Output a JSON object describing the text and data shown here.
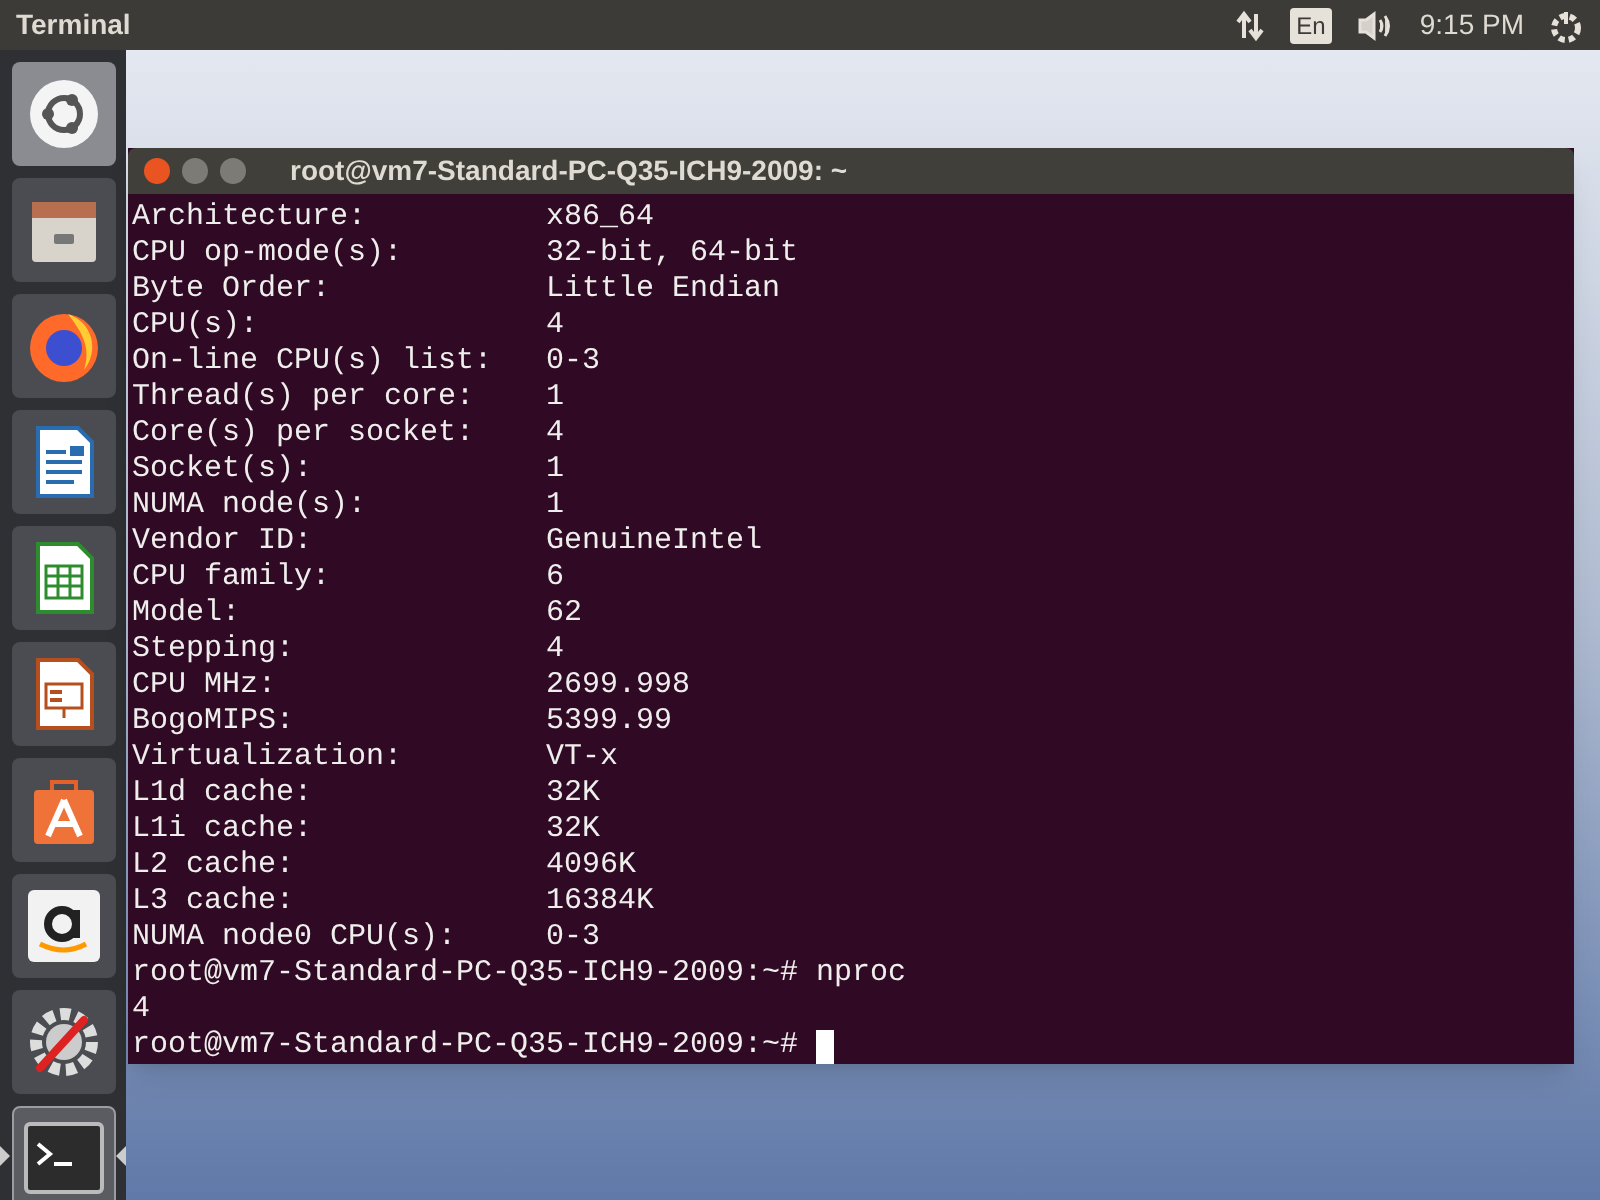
{
  "top_bar": {
    "app_title": "Terminal",
    "keyboard_layout": "En",
    "clock": "9:15 PM"
  },
  "launcher": {
    "items": [
      {
        "kind": "dash",
        "running": false
      },
      {
        "kind": "files",
        "running": false
      },
      {
        "kind": "browser",
        "running": false
      },
      {
        "kind": "writer",
        "running": false
      },
      {
        "kind": "calc",
        "running": false
      },
      {
        "kind": "impress",
        "running": false
      },
      {
        "kind": "software",
        "running": false
      },
      {
        "kind": "amazon",
        "running": false
      },
      {
        "kind": "settings",
        "running": false
      },
      {
        "kind": "terminal",
        "running": true
      }
    ]
  },
  "terminal": {
    "title": "root@vm7-Standard-PC-Q35-ICH9-2009: ~",
    "lines": [
      {
        "kind": "field",
        "label": "Architecture:",
        "value": "x86_64"
      },
      {
        "kind": "field",
        "label": "CPU op-mode(s):",
        "value": "32-bit, 64-bit"
      },
      {
        "kind": "field",
        "label": "Byte Order:",
        "value": "Little Endian"
      },
      {
        "kind": "field",
        "label": "CPU(s):",
        "value": "4"
      },
      {
        "kind": "field",
        "label": "On-line CPU(s) list:",
        "value": "0-3"
      },
      {
        "kind": "field",
        "label": "Thread(s) per core:",
        "value": "1"
      },
      {
        "kind": "field",
        "label": "Core(s) per socket:",
        "value": "4"
      },
      {
        "kind": "field",
        "label": "Socket(s):",
        "value": "1"
      },
      {
        "kind": "field",
        "label": "NUMA node(s):",
        "value": "1"
      },
      {
        "kind": "field",
        "label": "Vendor ID:",
        "value": "GenuineIntel"
      },
      {
        "kind": "field",
        "label": "CPU family:",
        "value": "6"
      },
      {
        "kind": "field",
        "label": "Model:",
        "value": "62"
      },
      {
        "kind": "field",
        "label": "Stepping:",
        "value": "4"
      },
      {
        "kind": "field",
        "label": "CPU MHz:",
        "value": "2699.998"
      },
      {
        "kind": "field",
        "label": "BogoMIPS:",
        "value": "5399.99"
      },
      {
        "kind": "field",
        "label": "Virtualization:",
        "value": "VT-x"
      },
      {
        "kind": "field",
        "label": "L1d cache:",
        "value": "32K"
      },
      {
        "kind": "field",
        "label": "L1i cache:",
        "value": "32K"
      },
      {
        "kind": "field",
        "label": "L2 cache:",
        "value": "4096K"
      },
      {
        "kind": "field",
        "label": "L3 cache:",
        "value": "16384K"
      },
      {
        "kind": "field",
        "label": "NUMA node0 CPU(s):",
        "value": "0-3"
      },
      {
        "kind": "command",
        "text": "root@vm7-Standard-PC-Q35-ICH9-2009:~# nproc"
      },
      {
        "kind": "output",
        "text": "4"
      },
      {
        "kind": "prompt",
        "text": "root@vm7-Standard-PC-Q35-ICH9-2009:~#"
      }
    ]
  }
}
